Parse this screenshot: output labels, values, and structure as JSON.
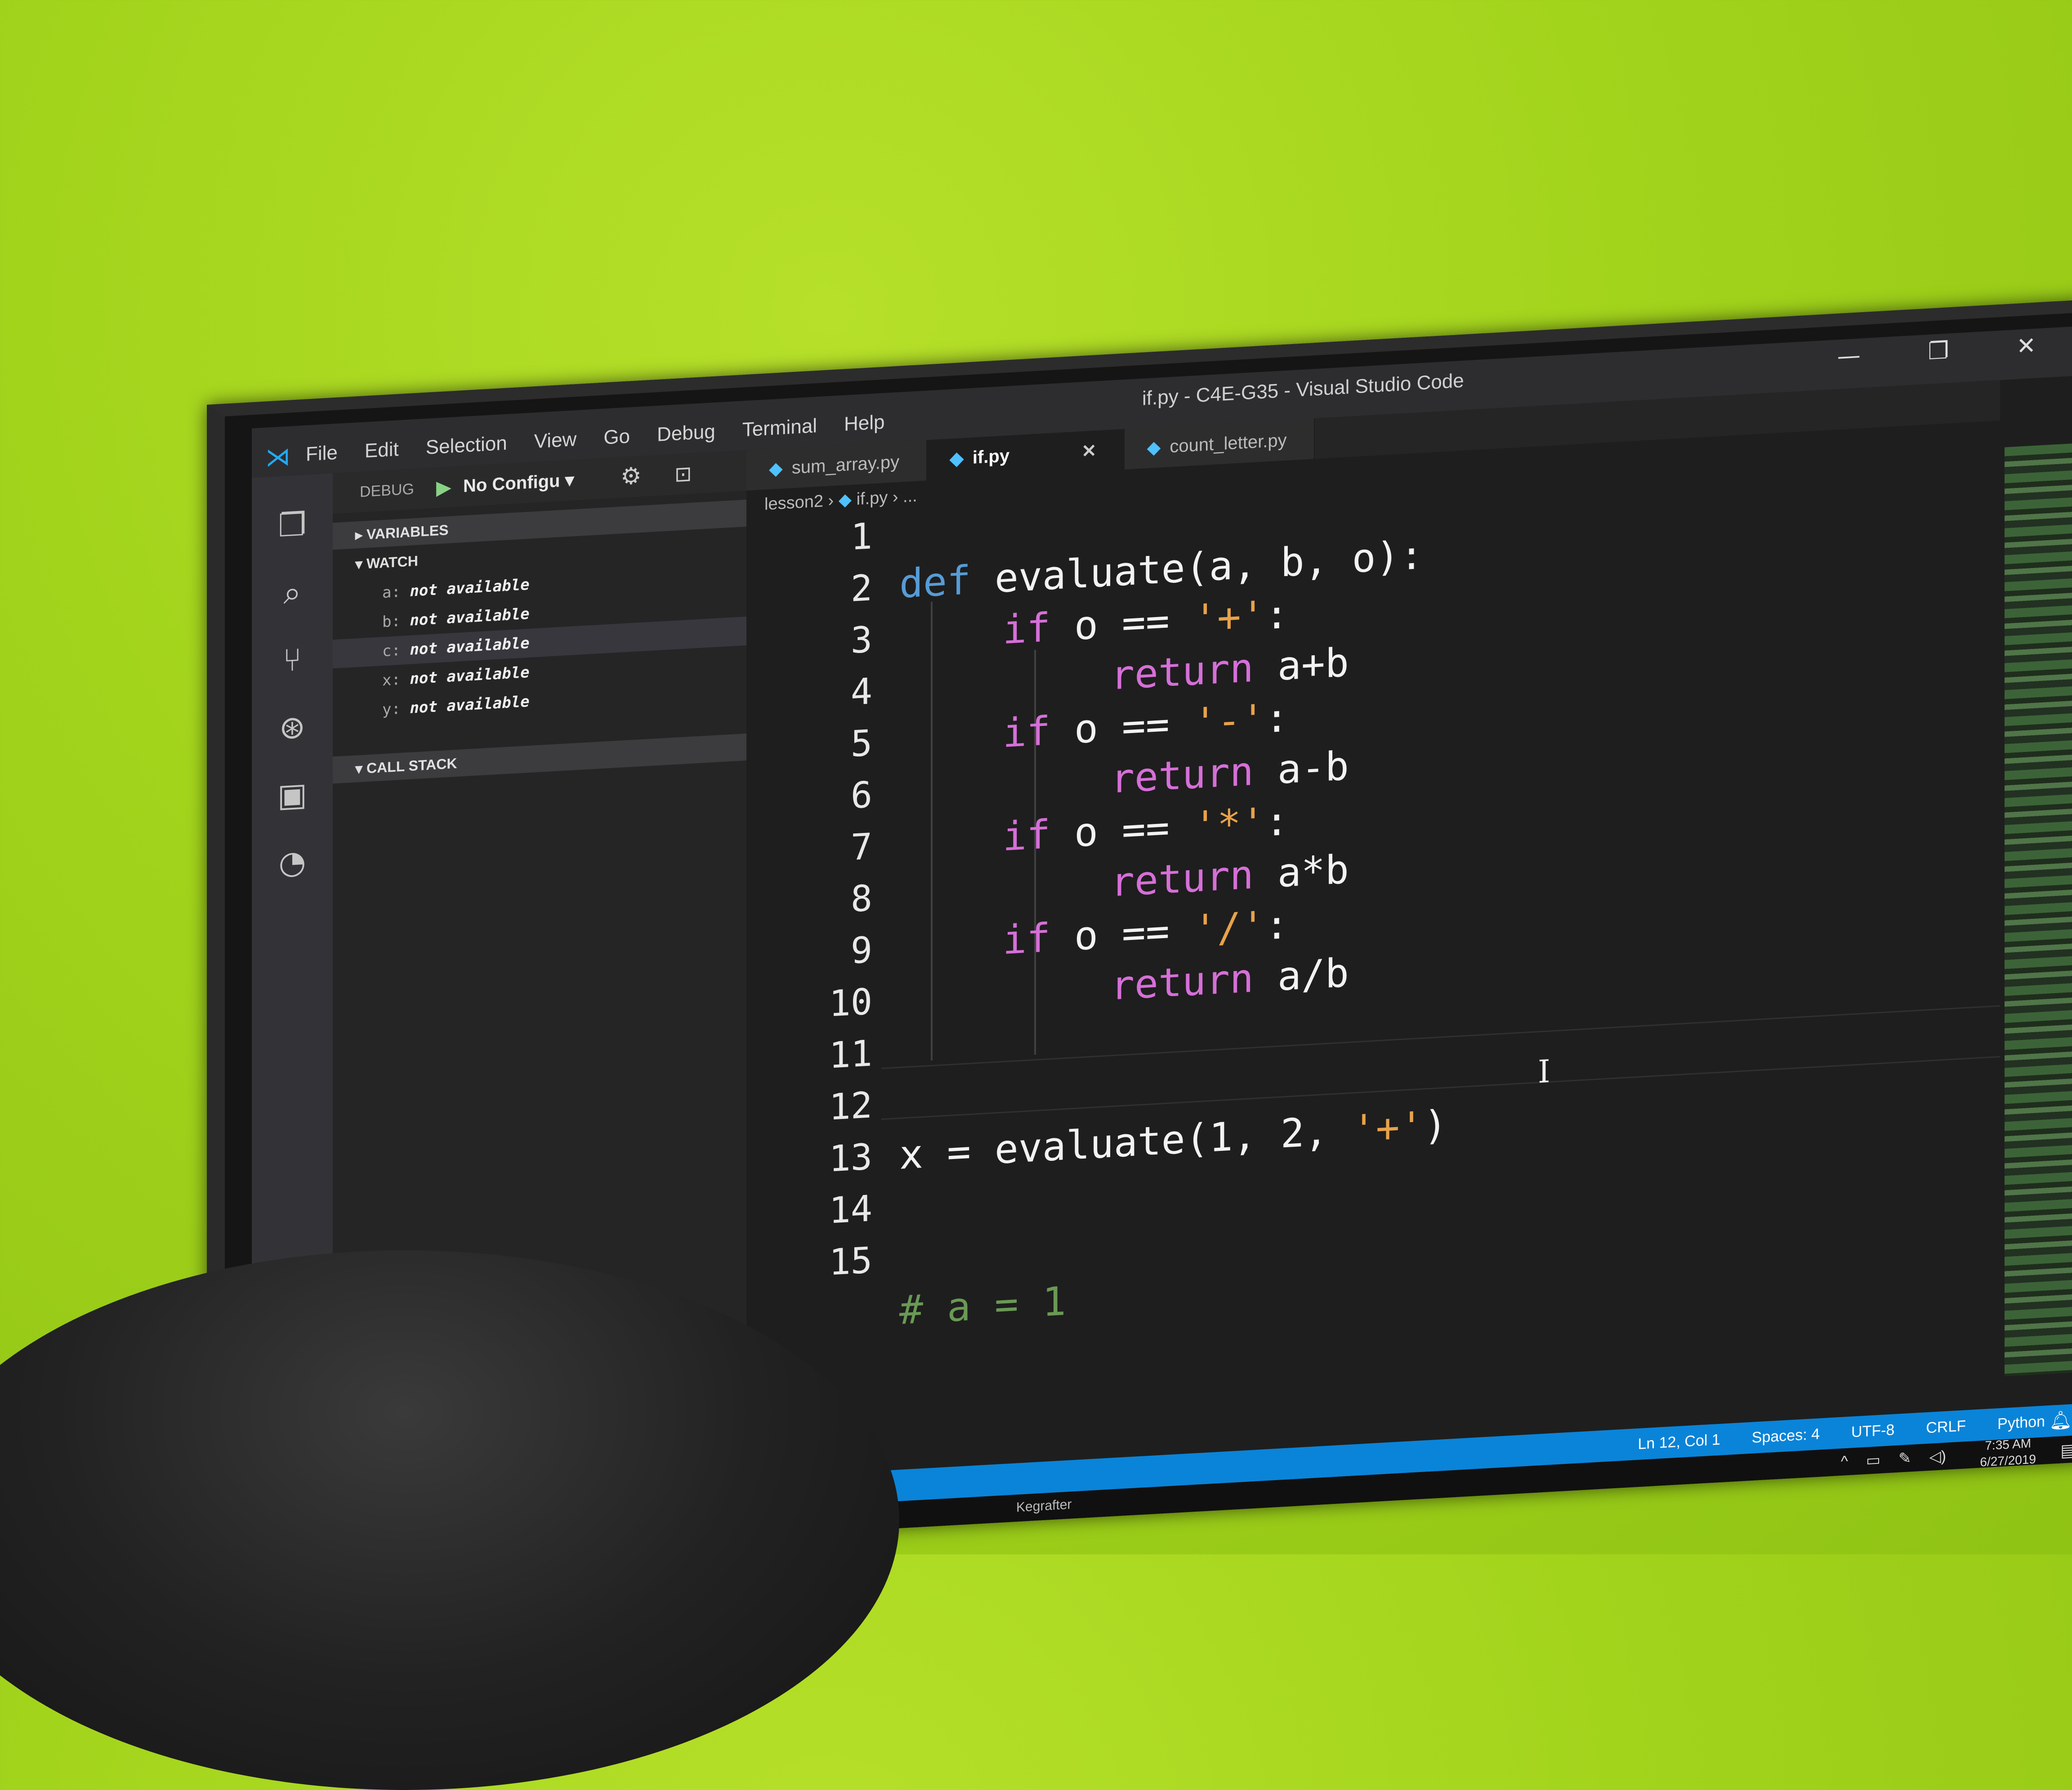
{
  "window": {
    "title": "if.py - C4E-G35 - Visual Studio Code",
    "menu": [
      "File",
      "Edit",
      "Selection",
      "View",
      "Go",
      "Debug",
      "Terminal",
      "Help"
    ],
    "controls": {
      "minimize": "—",
      "restore": "❐",
      "close": "✕"
    }
  },
  "debug_toolbar": {
    "label": "DEBUG",
    "config": "No Configu",
    "play_icon": "play-icon",
    "gear_icon": "gear-icon",
    "terminal_icon": "terminal-icon"
  },
  "sidebar": {
    "variables_header": "VARIABLES",
    "watch_header": "WATCH",
    "watch": [
      {
        "name": "a:",
        "value": "not available"
      },
      {
        "name": "b:",
        "value": "not available"
      },
      {
        "name": "c:",
        "value": "not available"
      },
      {
        "name": "x:",
        "value": "not available"
      },
      {
        "name": "y:",
        "value": "not available"
      }
    ],
    "call_stack_header": "CALL STACK"
  },
  "tabs": [
    {
      "label": "sum_array.py",
      "active": false
    },
    {
      "label": "if.py",
      "active": true
    },
    {
      "label": "count_letter.py",
      "active": false
    }
  ],
  "breadcrumb": {
    "folder": "lesson2",
    "file": "if.py",
    "more": "..."
  },
  "editor": {
    "line_numbers": [
      "1",
      "2",
      "3",
      "4",
      "5",
      "6",
      "7",
      "8",
      "9",
      "10",
      "11",
      "12",
      "13",
      "14",
      "15"
    ],
    "lines": {
      "l2": {
        "kw": "def",
        "rest": "evaluate(a, b, o):"
      },
      "l3": {
        "kw": "if",
        "mid": "o ==",
        "str": "'+'",
        "end": ":"
      },
      "l4": {
        "kw": "return",
        "rest": "a+b"
      },
      "l5": {
        "kw": "if",
        "mid": "o ==",
        "str": "'-'",
        "end": ":"
      },
      "l6": {
        "kw": "return",
        "rest": "a-b"
      },
      "l7": {
        "kw": "if",
        "mid": "o ==",
        "str": "'*'",
        "end": ":"
      },
      "l8": {
        "kw": "return",
        "rest": "a*b"
      },
      "l9": {
        "kw": "if",
        "mid": "o ==",
        "str": "'/'",
        "end": ":"
      },
      "l10": {
        "kw": "return",
        "rest": "a/b"
      },
      "l13": {
        "pre": "x = evaluate(1, 2,",
        "str": "'+'",
        "end": ")"
      },
      "l16": {
        "cmt": "# a = 1"
      }
    }
  },
  "status_bar": {
    "position": "Ln 12, Col 1",
    "spaces": "Spaces: 4",
    "encoding": "UTF-8",
    "eol": "CRLF",
    "language": "Python"
  },
  "taskbar": {
    "app": "Kegrafter",
    "time": "7:35 AM",
    "date": "6/27/2019"
  },
  "colors": {
    "wall": "#a3d41c",
    "editor_bg": "#1e1e1e",
    "status_bar": "#0a84d8",
    "keyword": "#d66fd8",
    "def": "#569cd6",
    "string": "#e8a24a"
  }
}
